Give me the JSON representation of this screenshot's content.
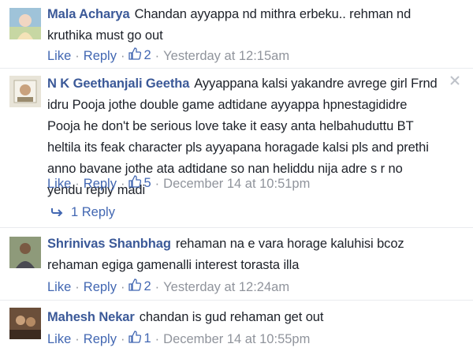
{
  "comments": [
    {
      "author": "Mala Acharya",
      "text": "Chandan ayyappa nd mithra erbeku.. rehman nd kruthika must go out",
      "like": "Like",
      "reply": "Reply",
      "likes": "2",
      "time": "Yesterday at 12:15am"
    },
    {
      "author": "N K Geethanjali Geetha",
      "text": "Ayyappana kalsi yakandre avrege girl Frnd idru Pooja jothe double game adtidane ayyappa hpnestagididre Pooja he don't be serious love take it easy anta helbahuduttu BT heltila its feak character pls ayyapana horagade kalsi pls and prethi anno bavane jothe ata adtidane so nan heliddu nija adre s r no yendu reply madi",
      "like": "Like",
      "reply": "Reply",
      "likes": "5",
      "time": "December 14 at 10:51pm",
      "replies_link": "1 Reply"
    },
    {
      "author": "Shrinivas Shanbhag",
      "text": "rehaman na e vara horage kaluhisi bcoz rehaman egiga gamenalli interest torasta illa",
      "like": "Like",
      "reply": "Reply",
      "likes": "2",
      "time": "Yesterday at 12:24am"
    },
    {
      "author": "Mahesh Nekar",
      "text": "chandan is gud rehaman get out",
      "like": "Like",
      "reply": "Reply",
      "likes": "1",
      "time": "December 14 at 10:55pm"
    }
  ],
  "icons": {
    "like": "thumbs-up-icon",
    "close": "close-icon",
    "reply_arrow": "reply-arrow-icon"
  },
  "colors": {
    "author": "#3b5998",
    "link": "#4267b2",
    "meta": "#90949c",
    "text": "#1d2129"
  }
}
